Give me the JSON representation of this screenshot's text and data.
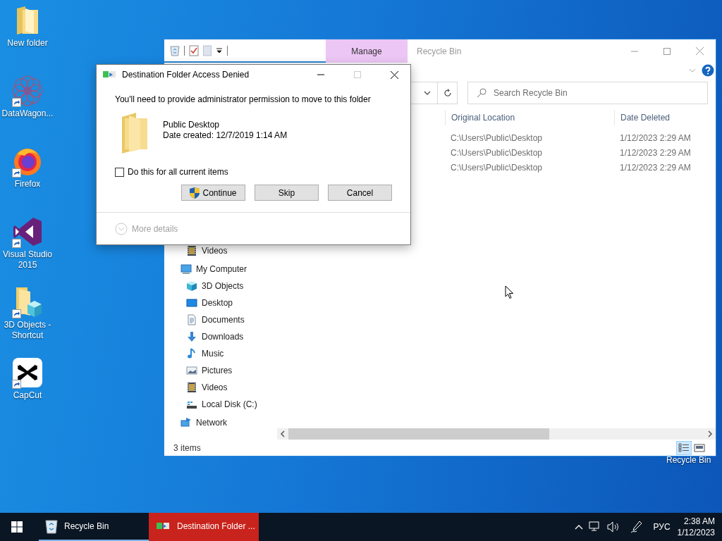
{
  "desktop": {
    "icons": [
      {
        "label": "New folder",
        "kind": "folder",
        "shortcut": false
      },
      {
        "label": "DataWagon...",
        "kind": "datawagon",
        "shortcut": true
      },
      {
        "label": "Firefox",
        "kind": "firefox",
        "shortcut": true
      },
      {
        "label": "Visual Studio 2015",
        "kind": "visual-studio",
        "shortcut": true
      },
      {
        "label": "3D Objects - Shortcut",
        "kind": "folder-3d",
        "shortcut": true
      },
      {
        "label": "CapCut",
        "kind": "capcut",
        "shortcut": true
      }
    ],
    "covered_icon_label": "Recycle Bin"
  },
  "explorer": {
    "title": "Recycle Bin",
    "context_tab": "Manage",
    "search": {
      "placeholder": "Search Recycle Bin"
    },
    "columns": [
      "Original Location",
      "Date Deleted"
    ],
    "rows": [
      {
        "original_location": "C:\\Users\\Public\\Desktop",
        "date_deleted": "1/12/2023 2:29 AM"
      },
      {
        "original_location": "C:\\Users\\Public\\Desktop",
        "date_deleted": "1/12/2023 2:29 AM"
      },
      {
        "original_location": "C:\\Users\\Public\\Desktop",
        "date_deleted": "1/12/2023 2:29 AM"
      }
    ],
    "nav_pane": {
      "previous_items": [
        {
          "label": "Videos",
          "kind": "videos"
        }
      ],
      "items": [
        {
          "label": "My Computer",
          "kind": "computer",
          "children": [
            {
              "label": "3D Objects",
              "kind": "cube"
            },
            {
              "label": "Desktop",
              "kind": "desktop"
            },
            {
              "label": "Documents",
              "kind": "documents"
            },
            {
              "label": "Downloads",
              "kind": "downloads"
            },
            {
              "label": "Music",
              "kind": "music"
            },
            {
              "label": "Pictures",
              "kind": "pictures"
            },
            {
              "label": "Videos",
              "kind": "videos"
            },
            {
              "label": "Local Disk (C:)",
              "kind": "disk"
            }
          ]
        },
        {
          "label": "Network",
          "kind": "network"
        }
      ]
    },
    "status_bar": "3 items",
    "views": [
      {
        "kind": "details",
        "selected": true
      },
      {
        "kind": "preview",
        "selected": false
      }
    ]
  },
  "dialog": {
    "title": "Destination Folder Access Denied",
    "message": "You'll need to provide administrator permission to move to this folder",
    "item": {
      "name": "Public Desktop",
      "date_created": "Date created: 12/7/2019 1:14 AM"
    },
    "checkbox": {
      "label": "Do this for all current items",
      "checked": false
    },
    "buttons": [
      {
        "label": "Continue",
        "kind": "shield"
      },
      {
        "label": "Skip",
        "kind": "plain"
      },
      {
        "label": "Cancel",
        "kind": "plain"
      }
    ],
    "more_details": {
      "label": "More details",
      "disabled": true
    }
  },
  "taskbar": {
    "items": [
      {
        "label": "Recycle Bin",
        "kind": "recycle-bin",
        "flashing": false
      },
      {
        "label": "Destination Folder ...",
        "kind": "file-transfer",
        "flashing": true
      }
    ],
    "language": "РУС",
    "time": "2:38 AM",
    "date": "1/12/2023"
  }
}
